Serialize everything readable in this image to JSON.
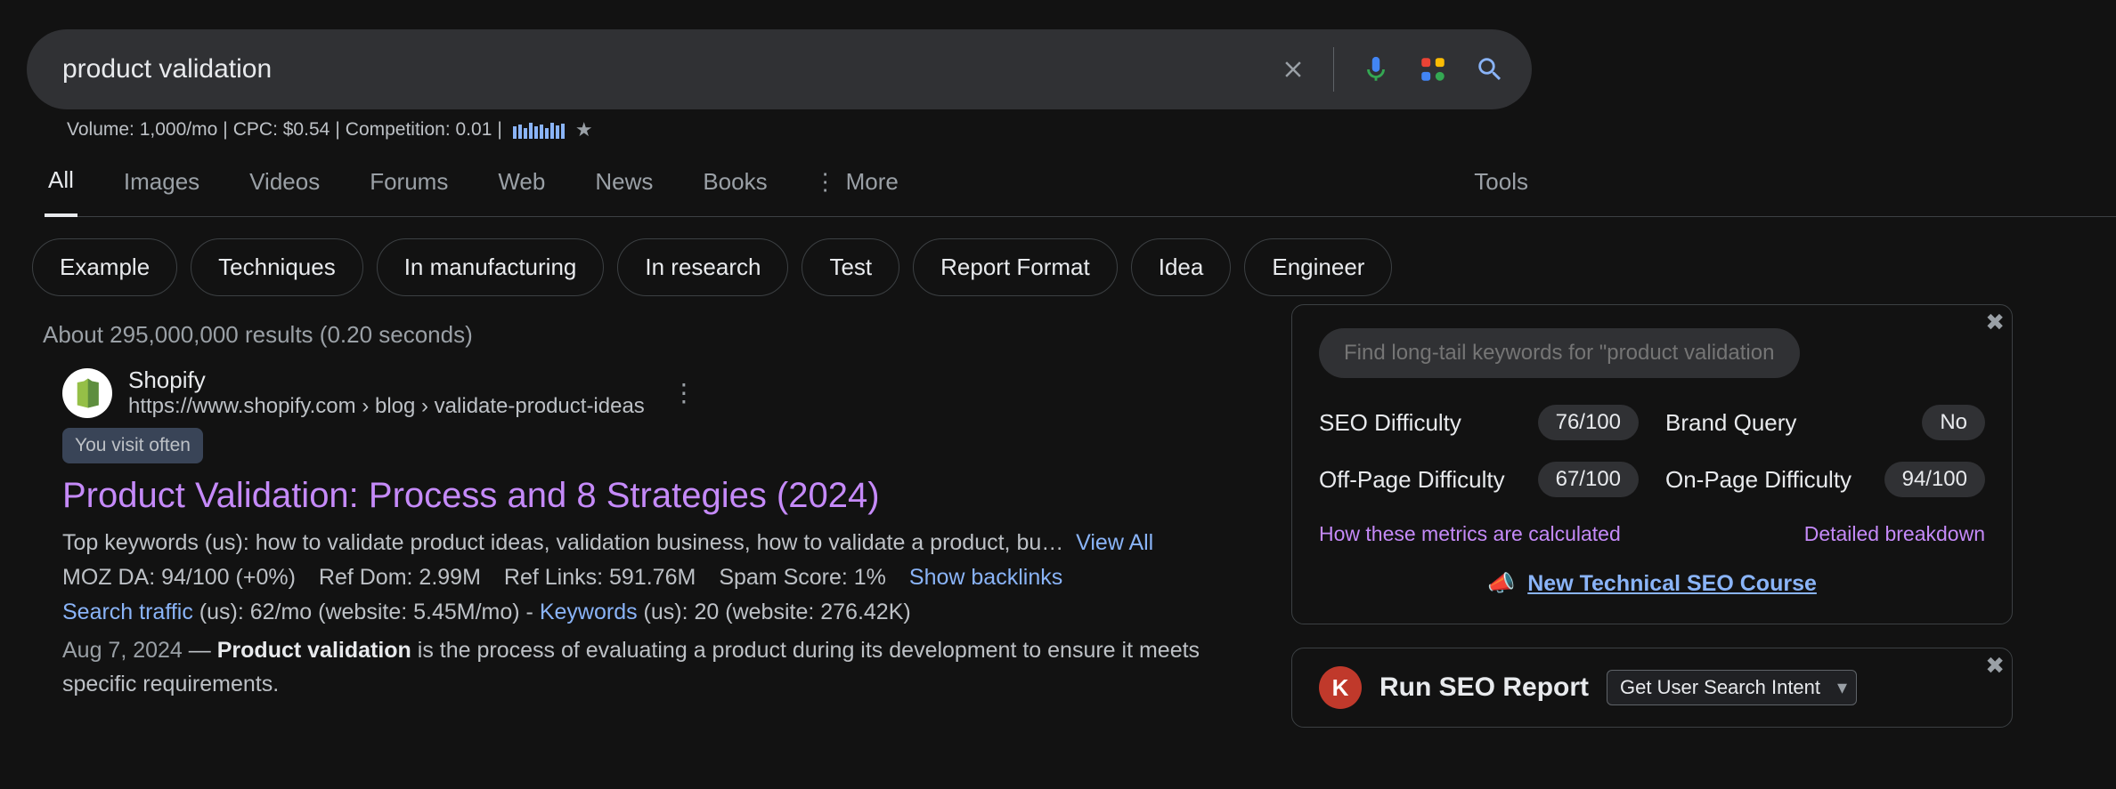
{
  "search": {
    "query": "product validation",
    "volume": "Volume: 1,000/mo",
    "cpc": "CPC: $0.54",
    "competition": "Competition: 0.01"
  },
  "tabs": {
    "all": "All",
    "images": "Images",
    "videos": "Videos",
    "forums": "Forums",
    "web": "Web",
    "news": "News",
    "books": "Books",
    "more": "More",
    "tools": "Tools"
  },
  "chips": {
    "example": "Example",
    "techniques": "Techniques",
    "in_manufacturing": "In manufacturing",
    "in_research": "In research",
    "test": "Test",
    "report_format": "Report Format",
    "idea": "Idea",
    "engineer": "Engineer"
  },
  "stats": "About 295,000,000 results (0.20 seconds)",
  "result": {
    "site_name": "Shopify",
    "breadcrumb": "https://www.shopify.com › blog › validate-product-ideas",
    "badge": "You visit often",
    "title": "Product Validation: Process and 8 Strategies (2024)",
    "keywords_prefix": "Top keywords (us): ",
    "keywords": "how to validate product ideas, validation business, how to validate a product, bu…",
    "view_all": "View All",
    "moz_da": "MOZ DA: 94/100 (+0%)",
    "ref_dom": "Ref Dom: 2.99M",
    "ref_links": "Ref Links: 591.76M",
    "spam_score": "Spam Score: 1%",
    "show_backlinks": "Show backlinks",
    "search_traffic_label": "Search traffic",
    "search_traffic_rest": " (us): 62/mo (website: 5.45M/mo) - ",
    "keywords_stat_label": "Keywords",
    "keywords_stat_rest": " (us): 20 (website: 276.42K)",
    "date": "Aug 7, 2024",
    "dash": " — ",
    "bold": "Product validation",
    "snippet_rest": " is the process of evaluating a product during its development to ensure it meets specific requirements."
  },
  "seo_panel": {
    "find_placeholder": "Find long-tail keywords for \"product validation\"",
    "seo_diff_label": "SEO Difficulty",
    "seo_diff_val": "76/100",
    "brand_query_label": "Brand Query",
    "brand_query_val": "No",
    "off_page_label": "Off-Page Difficulty",
    "off_page_val": "67/100",
    "on_page_label": "On-Page Difficulty",
    "on_page_val": "94/100",
    "how_calc": "How these metrics are calculated",
    "detailed": "Detailed breakdown",
    "course_emoji": "📣",
    "course_link": "New Technical SEO Course"
  },
  "run_panel": {
    "k": "K",
    "title": "Run SEO Report",
    "select": "Get User Search Intent"
  }
}
